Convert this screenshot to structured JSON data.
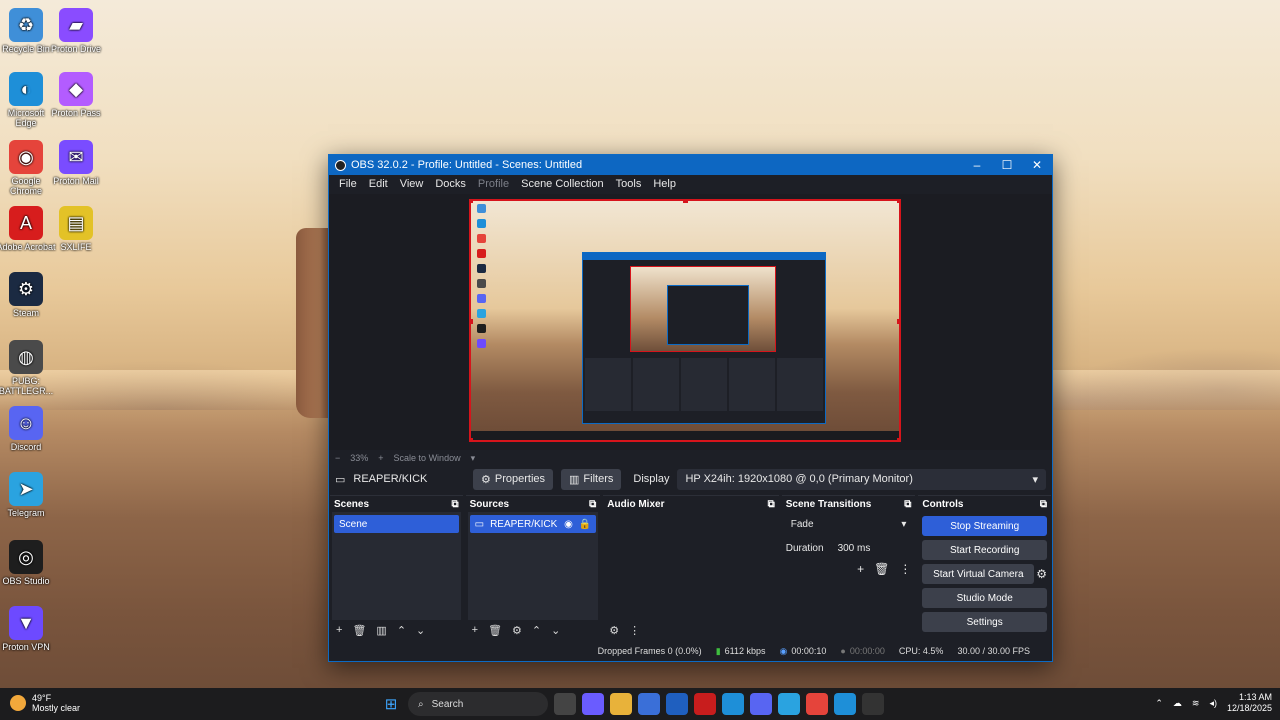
{
  "desktop": {
    "icons": [
      {
        "label": "Recycle Bin",
        "icon": "recycle-bin-icon",
        "color": "#3f8fd8"
      },
      {
        "label": "Proton Drive",
        "icon": "proton-drive-icon",
        "color": "#8a4cff"
      },
      {
        "label": "Microsoft Edge",
        "icon": "edge-icon",
        "color": "#1e8fd8"
      },
      {
        "label": "Proton Pass",
        "icon": "proton-pass-icon",
        "color": "#b35cff"
      },
      {
        "label": "Google Chrome",
        "icon": "chrome-icon",
        "color": "#e5443b"
      },
      {
        "label": "Proton Mail",
        "icon": "proton-mail-icon",
        "color": "#7a4cff"
      },
      {
        "label": "Adobe Acrobat",
        "icon": "acrobat-icon",
        "color": "#d71d1d"
      },
      {
        "label": "SXLIFE",
        "icon": "folder-icon",
        "color": "#e3c227"
      },
      {
        "label": "Steam",
        "icon": "steam-icon",
        "color": "#1b2a42"
      },
      {
        "label": "PUBG: BATTLEGR...",
        "icon": "pubg-icon",
        "color": "#4a4a4a"
      },
      {
        "label": "Discord",
        "icon": "discord-icon",
        "color": "#5865f2"
      },
      {
        "label": "Telegram",
        "icon": "telegram-icon",
        "color": "#2aa3e0"
      },
      {
        "label": "OBS Studio",
        "icon": "obs-icon",
        "color": "#1e1e1e"
      },
      {
        "label": "Proton VPN",
        "icon": "proton-vpn-icon",
        "color": "#6d4aff"
      }
    ]
  },
  "window": {
    "title": "OBS 32.0.2 - Profile: Untitled - Scenes: Untitled",
    "minimize": "–",
    "maximize": "☐",
    "close": "✕"
  },
  "menu": [
    "File",
    "Edit",
    "View",
    "Docks",
    "Profile",
    "Scene Collection",
    "Tools",
    "Help"
  ],
  "preview": {
    "zoom": "33%",
    "scale_mode": "Scale to Window"
  },
  "source_toolbar": {
    "source_name": "REAPER/KICK",
    "properties": "Properties",
    "filters": "Filters",
    "display_label": "Display",
    "display_value": "HP X24ih: 1920x1080 @ 0,0 (Primary Monitor)"
  },
  "docks": {
    "scenes": {
      "title": "Scenes",
      "items": [
        "Scene"
      ]
    },
    "sources": {
      "title": "Sources",
      "items": [
        "REAPER/KICK"
      ]
    },
    "mixer": {
      "title": "Audio Mixer"
    },
    "transitions": {
      "title": "Scene Transitions",
      "transition": "Fade",
      "duration_label": "Duration",
      "duration_value": "300 ms"
    },
    "controls": {
      "title": "Controls",
      "stop_streaming": "Stop Streaming",
      "start_recording": "Start Recording",
      "start_virtual_camera": "Start Virtual Camera",
      "studio_mode": "Studio Mode",
      "settings": "Settings"
    }
  },
  "status": {
    "dropped_frames": "Dropped Frames 0 (0.0%)",
    "bitrate": "6112 kbps",
    "stream_time": "00:00:10",
    "record_time": "00:00:00",
    "cpu": "CPU: 4.5%",
    "fps": "30.00 / 30.00 FPS"
  },
  "taskbar": {
    "weather_temp": "49°F",
    "weather_desc": "Mostly clear",
    "search": "Search",
    "time": "1:13 AM",
    "date": "12/18/2025"
  },
  "colors": {
    "accent": "#2e5fd8",
    "titlebar": "#0d67c2",
    "preview_border": "#d6141b"
  }
}
